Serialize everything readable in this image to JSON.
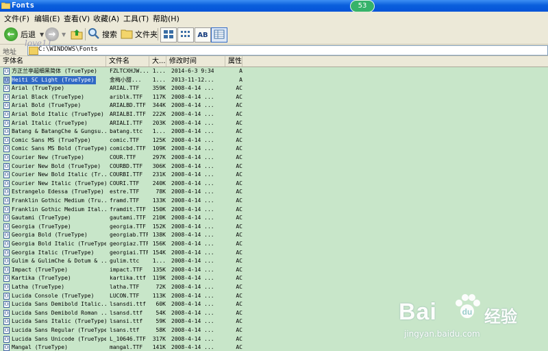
{
  "window": {
    "title": "Fonts",
    "page_badge": "53"
  },
  "menu": [
    "文件(F)",
    "编辑(E)",
    "查看(V)",
    "收藏(A)",
    "工具(T)",
    "帮助(H)"
  ],
  "toolbar": {
    "back_label": "后退",
    "search_label": "搜索",
    "folders_label": "文件夹",
    "view_ab": "AB"
  },
  "address": {
    "label": "地址",
    "path": "C:\\WINDOWS\\Fonts"
  },
  "columns": {
    "name": "字体名",
    "file": "文件名",
    "size": "大...",
    "modified": "修改时间",
    "attr": "属性"
  },
  "rows": [
    {
      "name": "方正兰亭超细黑简体 (TrueType)",
      "file": "FZLTCXHJW...",
      "size": "1...",
      "date": "2014-6-3 9:34",
      "attr": "A"
    },
    {
      "name": "Heiti SC Light (TrueType)",
      "file": "金梅小甜...",
      "size": "1...",
      "date": "2013-11-12...",
      "attr": "A",
      "selected": true
    },
    {
      "name": "Arial (TrueType)",
      "file": "ARIAL.TTF",
      "size": "359K",
      "date": "2008-4-14 ...",
      "attr": "AC"
    },
    {
      "name": "Arial Black (TrueType)",
      "file": "ariblk.TTF",
      "size": "117K",
      "date": "2008-4-14 ...",
      "attr": "AC"
    },
    {
      "name": "Arial Bold (TrueType)",
      "file": "ARIALBD.TTF",
      "size": "344K",
      "date": "2008-4-14 ...",
      "attr": "AC"
    },
    {
      "name": "Arial Bold Italic (TrueType)",
      "file": "ARIALBI.TTF",
      "size": "222K",
      "date": "2008-4-14 ...",
      "attr": "AC"
    },
    {
      "name": "Arial Italic (TrueType)",
      "file": "ARIALI.TTF",
      "size": "203K",
      "date": "2008-4-14 ...",
      "attr": "AC"
    },
    {
      "name": "Batang & BatangChe & Gungsu...",
      "file": "batang.ttc",
      "size": "1...",
      "date": "2008-4-14 ...",
      "attr": "AC"
    },
    {
      "name": "Comic Sans MS (TrueType)",
      "file": "comic.TTF",
      "size": "125K",
      "date": "2008-4-14 ...",
      "attr": "AC"
    },
    {
      "name": "Comic Sans MS Bold (TrueType)",
      "file": "comicbd.TTF",
      "size": "109K",
      "date": "2008-4-14 ...",
      "attr": "AC"
    },
    {
      "name": "Courier New (TrueType)",
      "file": "COUR.TTF",
      "size": "297K",
      "date": "2008-4-14 ...",
      "attr": "AC"
    },
    {
      "name": "Courier New Bold (TrueType)",
      "file": "COURBD.TTF",
      "size": "306K",
      "date": "2008-4-14 ...",
      "attr": "AC"
    },
    {
      "name": "Courier New Bold Italic (Tr...",
      "file": "COURBI.TTF",
      "size": "231K",
      "date": "2008-4-14 ...",
      "attr": "AC"
    },
    {
      "name": "Courier New Italic (TrueType)",
      "file": "COURI.TTF",
      "size": "240K",
      "date": "2008-4-14 ...",
      "attr": "AC"
    },
    {
      "name": "Estrangelo Edessa (TrueType)",
      "file": "estre.TTF",
      "size": "78K",
      "date": "2008-4-14 ...",
      "attr": "AC"
    },
    {
      "name": "Franklin Gothic Medium (Tru...",
      "file": "framd.TTF",
      "size": "133K",
      "date": "2008-4-14 ...",
      "attr": "AC"
    },
    {
      "name": "Franklin Gothic Medium Ital...",
      "file": "framdit.TTF",
      "size": "150K",
      "date": "2008-4-14 ...",
      "attr": "AC"
    },
    {
      "name": "Gautami (TrueType)",
      "file": "gautami.TTF",
      "size": "210K",
      "date": "2008-4-14 ...",
      "attr": "AC"
    },
    {
      "name": "Georgia (TrueType)",
      "file": "georgia.TTF",
      "size": "152K",
      "date": "2008-4-14 ...",
      "attr": "AC"
    },
    {
      "name": "Georgia Bold (TrueType)",
      "file": "georgiab.TTF",
      "size": "138K",
      "date": "2008-4-14 ...",
      "attr": "AC"
    },
    {
      "name": "Georgia Bold Italic (TrueType)",
      "file": "georgiaz.TTF",
      "size": "156K",
      "date": "2008-4-14 ...",
      "attr": "AC"
    },
    {
      "name": "Georgia Italic (TrueType)",
      "file": "georgiai.TTF",
      "size": "154K",
      "date": "2008-4-14 ...",
      "attr": "AC"
    },
    {
      "name": "Gulim & GulimChe & Dotum & ...",
      "file": "gulim.ttc",
      "size": "1...",
      "date": "2008-4-14 ...",
      "attr": "AC"
    },
    {
      "name": "Impact (TrueType)",
      "file": "impact.TTF",
      "size": "135K",
      "date": "2008-4-14 ...",
      "attr": "AC"
    },
    {
      "name": "Kartika (TrueType)",
      "file": "kartika.ttf",
      "size": "119K",
      "date": "2008-4-14 ...",
      "attr": "AC"
    },
    {
      "name": "Latha (TrueType)",
      "file": "latha.TTF",
      "size": "72K",
      "date": "2008-4-14 ...",
      "attr": "AC"
    },
    {
      "name": "Lucida Console (TrueType)",
      "file": "LUCON.TTF",
      "size": "113K",
      "date": "2008-4-14 ...",
      "attr": "AC"
    },
    {
      "name": "Lucida Sans Demibold Italic...",
      "file": "lsansdi.ttf",
      "size": "60K",
      "date": "2008-4-14 ...",
      "attr": "AC"
    },
    {
      "name": "Lucida Sans Demibold Roman ...",
      "file": "lsansd.ttf",
      "size": "54K",
      "date": "2008-4-14 ...",
      "attr": "AC"
    },
    {
      "name": "Lucida Sans Italic (TrueType)",
      "file": "lsansi.ttf",
      "size": "59K",
      "date": "2008-4-14 ...",
      "attr": "AC"
    },
    {
      "name": "Lucida Sans Regular (TrueType)",
      "file": "lsans.ttf",
      "size": "58K",
      "date": "2008-4-14 ...",
      "attr": "AC"
    },
    {
      "name": "Lucida Sans Unicode (TrueType)",
      "file": "L_10646.TTF",
      "size": "317K",
      "date": "2008-4-14 ...",
      "attr": "AC"
    },
    {
      "name": "Mangal (TrueType)",
      "file": "mangal.TTF",
      "size": "141K",
      "date": "2008-4-14 ...",
      "attr": "AC"
    }
  ],
  "watermark": {
    "logo": "Bai",
    "logo_cn": "经验",
    "url": "jingyan.baidu.com",
    "signature": "love11"
  },
  "colors": {
    "list_bg": "#c8e6c9",
    "selection": "#316ac5",
    "titlebar": "#0a5fdc"
  }
}
